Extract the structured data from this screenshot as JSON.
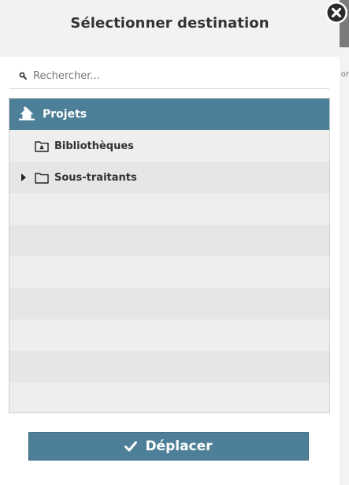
{
  "dialog": {
    "title": "Sélectionner destination"
  },
  "search": {
    "placeholder": "Rechercher..."
  },
  "tree": {
    "root": {
      "label": "Projets",
      "icon": "home-icon"
    },
    "items": [
      {
        "label": "Bibliothèques",
        "icon": "library-folder-icon",
        "expandable": false
      },
      {
        "label": "Sous-traitants",
        "icon": "folder-icon",
        "expandable": true
      }
    ]
  },
  "actions": {
    "move_label": "Déplacer",
    "move_icon": "check-icon"
  },
  "background": {
    "clipped_text": "or"
  },
  "colors": {
    "accent": "#4d7f98",
    "header_bg": "#f2f2f2",
    "tree_bg": "#ebebeb"
  }
}
